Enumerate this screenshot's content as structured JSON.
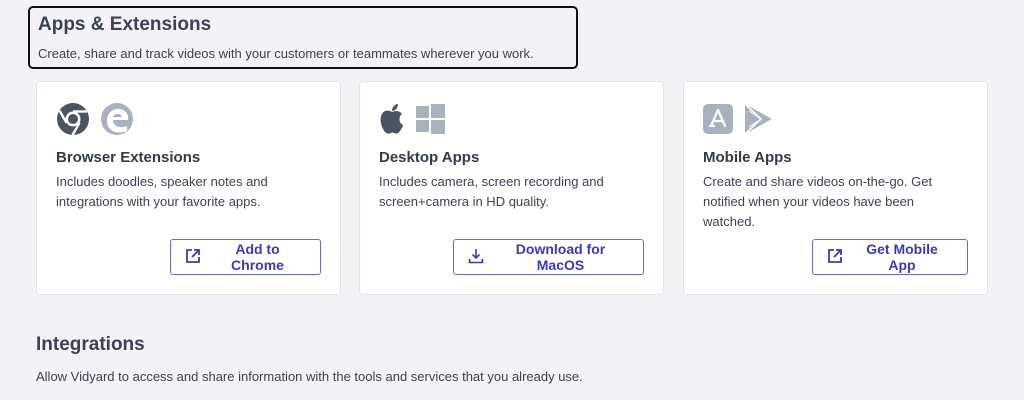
{
  "header": {
    "title": "Apps & Extensions",
    "subtitle": "Create, share and track videos with your customers or teammates wherever you work."
  },
  "cards": [
    {
      "title": "Browser Extensions",
      "description": "Includes doodles, speaker notes and integrations with your favorite apps.",
      "button": "Add to Chrome",
      "icons": [
        "chrome-icon",
        "edge-icon"
      ]
    },
    {
      "title": "Desktop Apps",
      "description": "Includes camera, screen recording and screen+camera in HD quality.",
      "button": "Download for MacOS",
      "icons": [
        "apple-icon",
        "windows-icon"
      ]
    },
    {
      "title": "Mobile Apps",
      "description": "Create and share videos on-the-go. Get notified when your videos have been watched.",
      "button": "Get Mobile App",
      "icons": [
        "app-store-icon",
        "google-play-icon"
      ]
    }
  ],
  "integrations": {
    "title": "Integrations",
    "description": "Allow Vidyard to access and share information with the tools and services that you already use."
  },
  "colors": {
    "background": "#f2f2f7",
    "accent": "#3a3ab8",
    "icon_gray": "#5b6270",
    "icon_light": "#a9b1c0"
  }
}
